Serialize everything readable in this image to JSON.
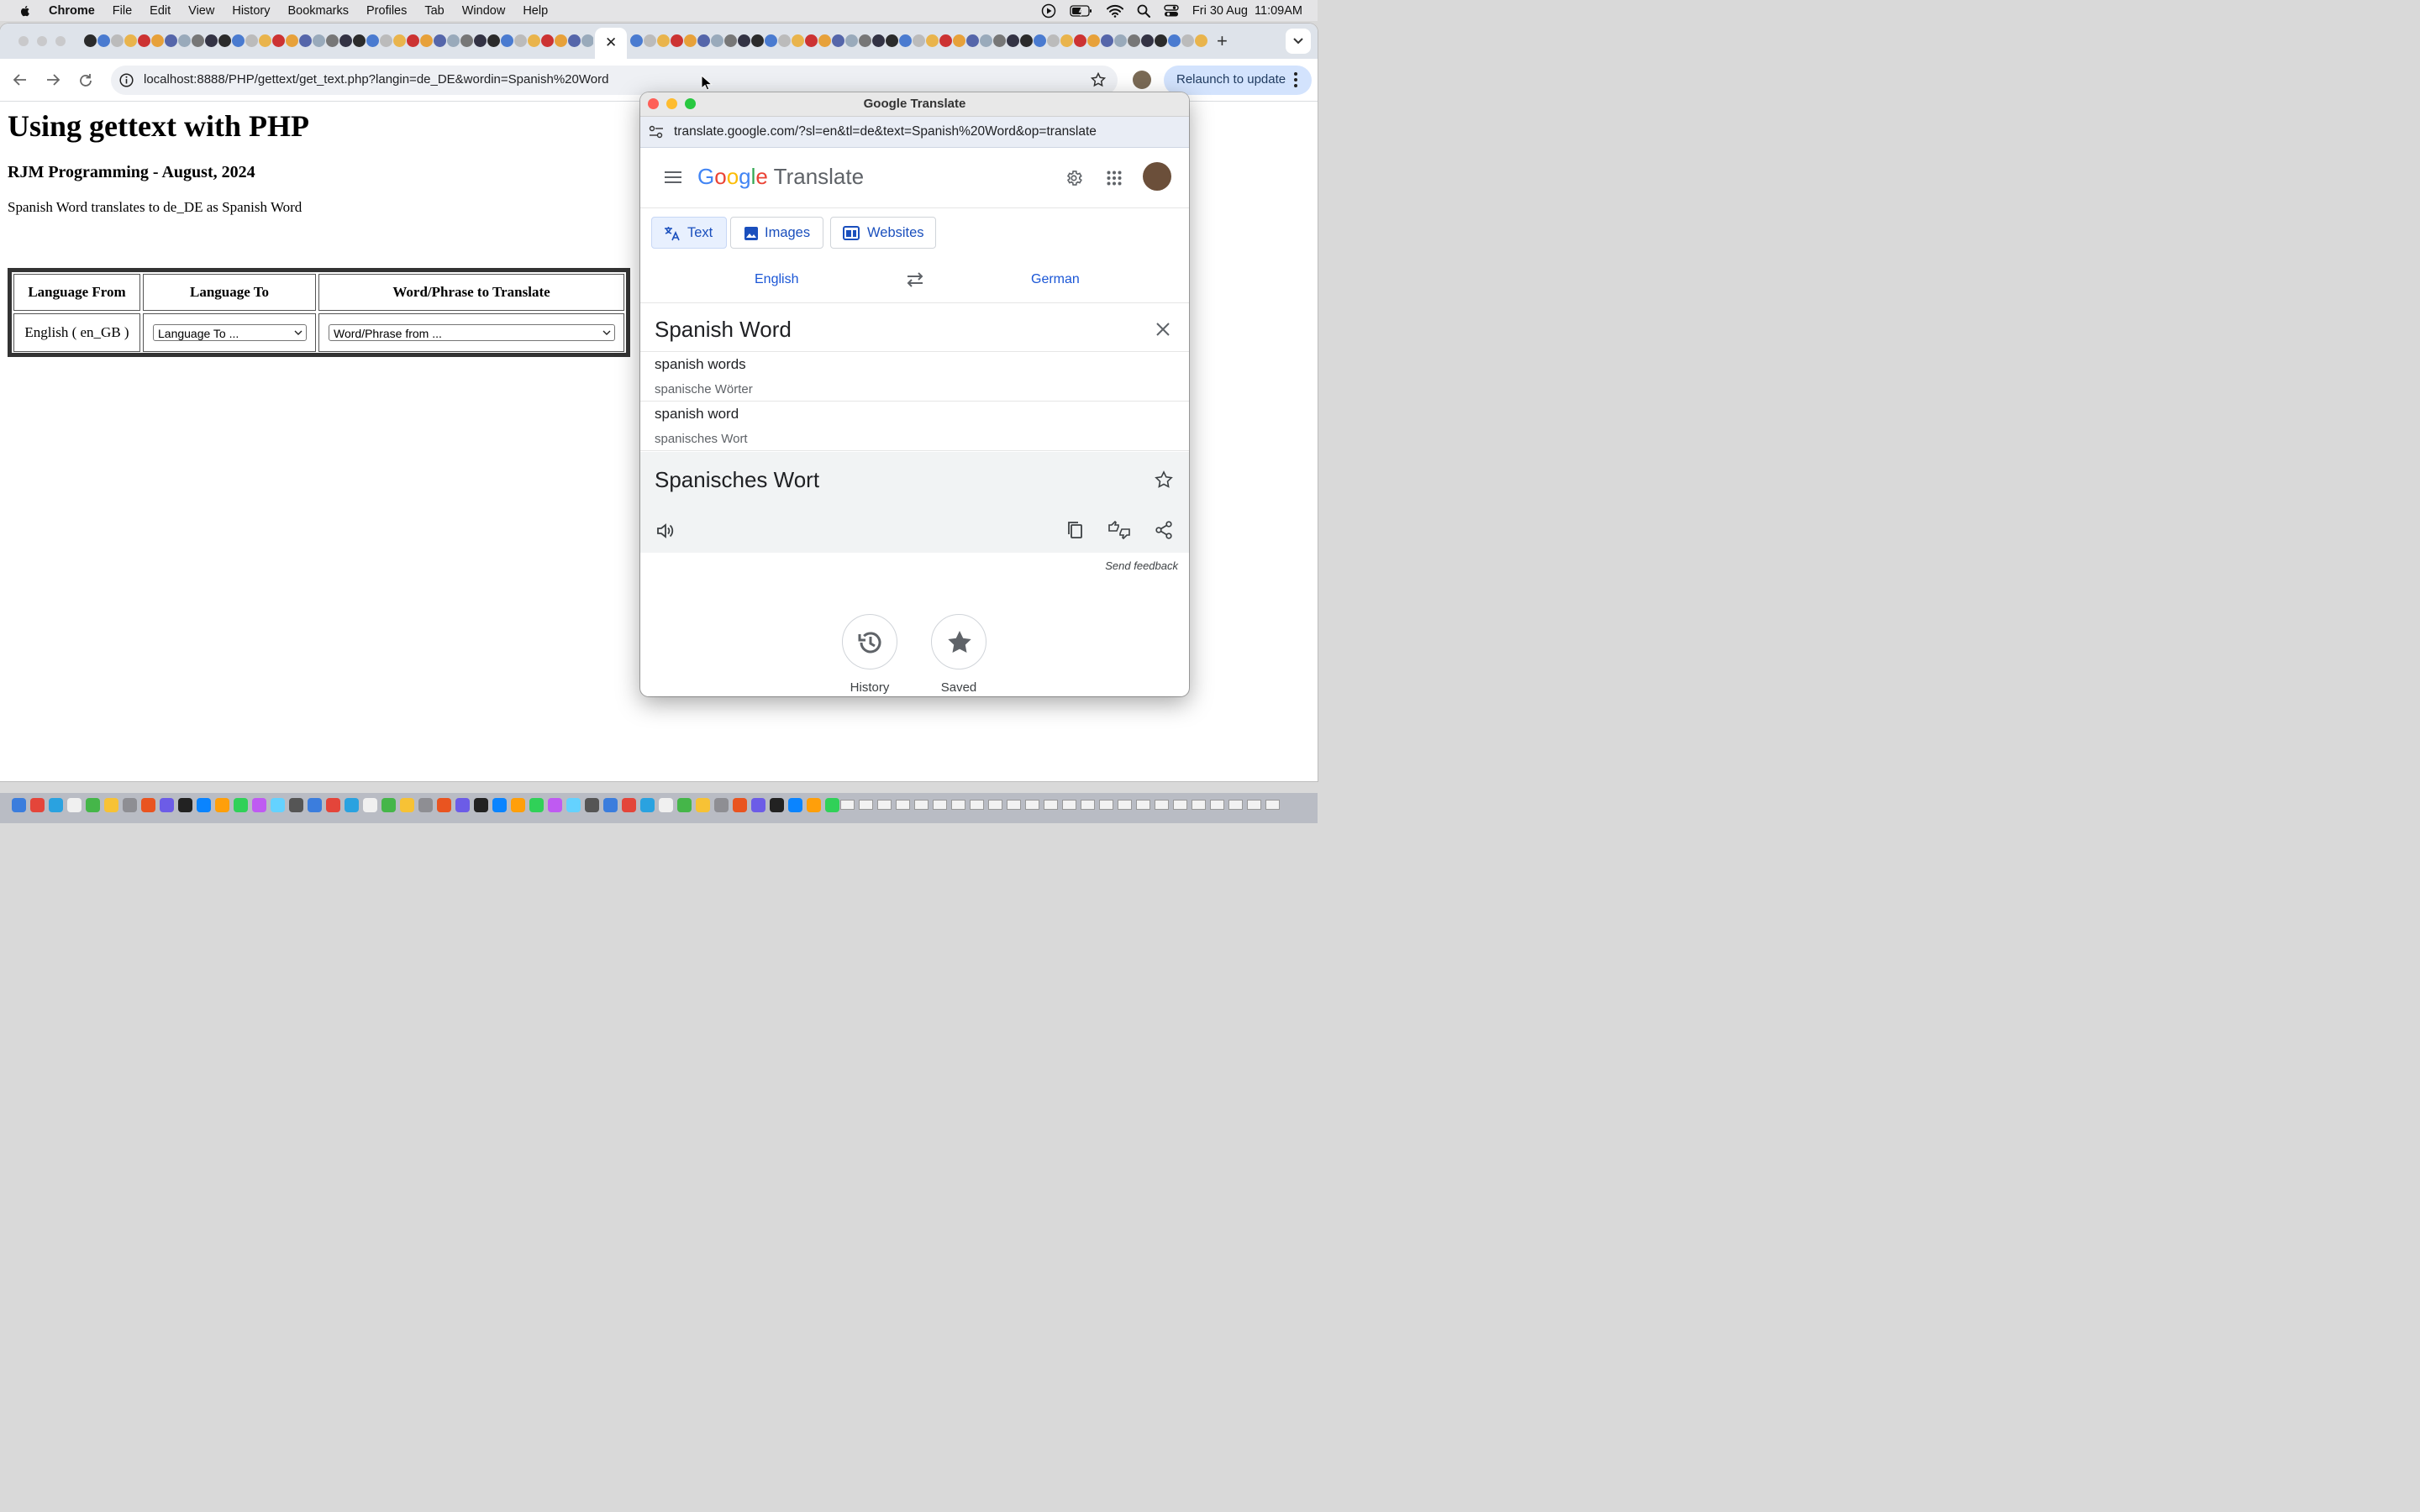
{
  "menubar": {
    "app": "Chrome",
    "items": [
      "File",
      "Edit",
      "View",
      "History",
      "Bookmarks",
      "Profiles",
      "Tab",
      "Window",
      "Help"
    ],
    "datetime": "Fri 30 Aug  11:09AM"
  },
  "browser": {
    "url": "localhost:8888/PHP/gettext/get_text.php?langin=de_DE&wordin=Spanish%20Word",
    "relaunch_label": "Relaunch to update",
    "close_tab_glyph": "✕",
    "new_tab_glyph": "+"
  },
  "page": {
    "title": "Using gettext with PHP",
    "subtitle": "RJM Programming - August, 2024",
    "message": "Spanish Word translates to de_DE as Spanish Word",
    "table": {
      "headers": [
        "Language From",
        "Language To",
        "Word/Phrase to Translate"
      ],
      "language_from": "English ( en_GB )",
      "language_to_select": "Language To ...",
      "word_select": "Word/Phrase from ..."
    }
  },
  "popup": {
    "title": "Google Translate",
    "url": "translate.google.com/?sl=en&tl=de&text=Spanish%20Word&op=translate",
    "logo_google": [
      "G",
      "o",
      "o",
      "g",
      "l",
      "e"
    ],
    "logo_translate": "Translate",
    "modes": [
      "Text",
      "Images",
      "Websites"
    ],
    "source_lang": "English",
    "target_lang": "German",
    "source_text": "Spanish Word",
    "suggestions": [
      {
        "text": "spanish words",
        "translation": "spanische Wörter"
      },
      {
        "text": "spanish word",
        "translation": "spanisches Wort"
      }
    ],
    "result_text": "Spanisches Wort",
    "feedback": "Send feedback",
    "history_label": "History",
    "saved_label": "Saved"
  },
  "colors": {
    "google_blue": "#4285F4",
    "google_red": "#EA4335",
    "google_yellow": "#FBBC05",
    "google_green": "#34A853",
    "link_blue": "#1a56d6"
  }
}
